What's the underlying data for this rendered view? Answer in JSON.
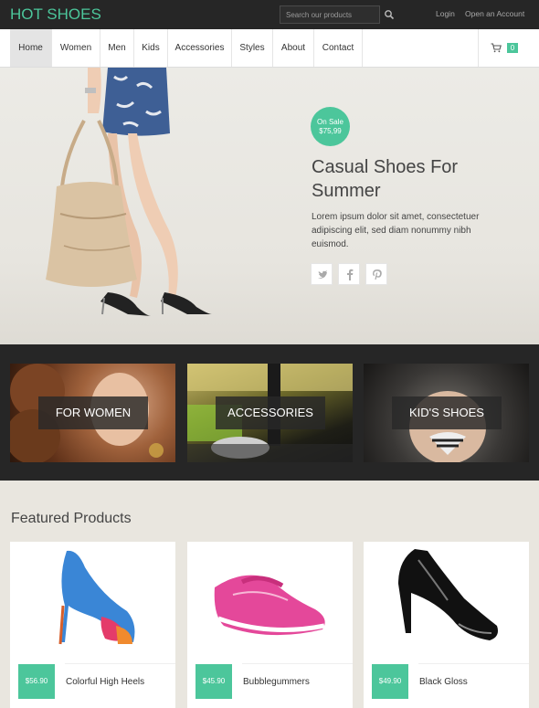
{
  "brand": {
    "logo": "HOT SHOES",
    "accent": "#4cc69b"
  },
  "topbar": {
    "search_placeholder": "Search our products",
    "login": "Login",
    "open_account": "Open an Account"
  },
  "nav": {
    "items": [
      {
        "label": "Home"
      },
      {
        "label": "Women"
      },
      {
        "label": "Men"
      },
      {
        "label": "Kids"
      },
      {
        "label": "Accessories"
      },
      {
        "label": "Styles"
      },
      {
        "label": "About"
      },
      {
        "label": "Contact"
      }
    ],
    "active": "Home",
    "cart_count": "0"
  },
  "hero": {
    "badge_line1": "On Sale",
    "badge_line2": "$75,99",
    "title": "Casual Shoes For Summer",
    "text": "Lorem ipsum dolor sit amet, consectetuer adipiscing elit, sed diam nonummy nibh euismod.",
    "social": [
      "twitter-icon",
      "facebook-icon",
      "pinterest-icon"
    ]
  },
  "categories": [
    {
      "label": "FOR WOMEN"
    },
    {
      "label": "ACCESSORIES"
    },
    {
      "label": "KID'S SHOES"
    }
  ],
  "featured": {
    "title": "Featured Products",
    "products": [
      {
        "price": "$56.90",
        "name": "Colorful High Heels"
      },
      {
        "price": "$45.90",
        "name": "Bubblegummers"
      },
      {
        "price": "$49.90",
        "name": "Black Gloss"
      }
    ]
  }
}
